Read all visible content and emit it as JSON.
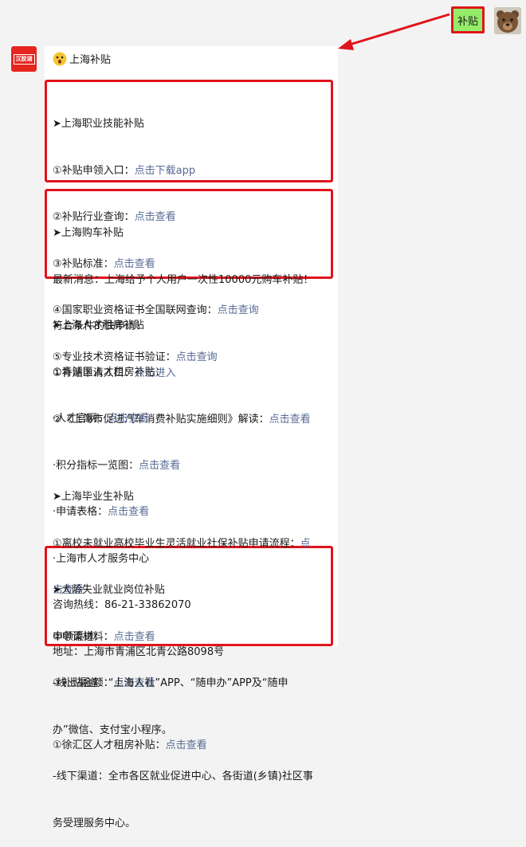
{
  "user_message": "补贴",
  "bot_title": "上海补贴",
  "bot_logo_text": "汉胶湖",
  "section1": {
    "title": "➤上海职业技能补贴",
    "lines": [
      {
        "label": "①补贴申领入口：",
        "link": "点击下载app"
      },
      {
        "label": "②补贴行业查询：",
        "link": "点击查看"
      },
      {
        "label": "③补贴标准：",
        "link": "点击查看"
      },
      {
        "label": "④国家职业资格证书全国联网查询：",
        "link": "点击查询"
      },
      {
        "label": "⑤专业技术资格证书验证：",
        "link": "点击查询"
      }
    ]
  },
  "section2": {
    "title": "➤上海购车补贴",
    "news_1": "最新消息：上海给予个人用户一次性10000元购车补贴！",
    "news_2": "符合条件的快申请！",
    "lines": [
      {
        "label": "①补贴申请入口：",
        "link": "点击进入"
      },
      {
        "label": "②《上海市促进汽车消费补贴实施细则》解读：",
        "link": "点击查看"
      }
    ]
  },
  "section3": {
    "title": "➤上海人才租房补贴",
    "sub1": "①青浦区人才租房补贴：",
    "items": [
      {
        "label": "·人才官网：",
        "link": "点击查看"
      },
      {
        "label": "·积分指标一览图：",
        "link": "点击查看"
      },
      {
        "label": "·申请表格：",
        "link": "点击查看"
      }
    ],
    "center": "·上海市人才服务中心",
    "hotline": "咨询热线：86-21-33862070",
    "address": "地址：上海市青浦区北青公路8098号",
    "sub2_label": "①徐汇区人才租房补贴：",
    "sub2_link": "点击查看"
  },
  "section4": {
    "title": "➤上海毕业生补贴",
    "line1_label": "①离校未就业高校毕业生灵活就业社保补贴申请流程：",
    "line1_link_a": "点",
    "line1_link_b": "击查看",
    "lines": [
      {
        "label": "②申请材料：",
        "link": "点击查看"
      },
      {
        "label": "③补贴金额：",
        "link": "点击查看"
      }
    ]
  },
  "section5": {
    "title": "➤大龄失业就业岗位补贴",
    "channels": "申领渠道：",
    "online_1": "-线上渠道：“上海人社”APP、“随申办”APP及“随申",
    "online_2": "办”微信、支付宝小程序。",
    "offline_1": "-线下渠道：全市各区就业促进中心、各街道(乡镇)社区事",
    "offline_2": "务受理服务中心。"
  },
  "colors": {
    "link": "#576b95",
    "highlight_border": "#e1131b",
    "user_bubble": "#95ec69",
    "bot_logo": "#e4261f"
  }
}
